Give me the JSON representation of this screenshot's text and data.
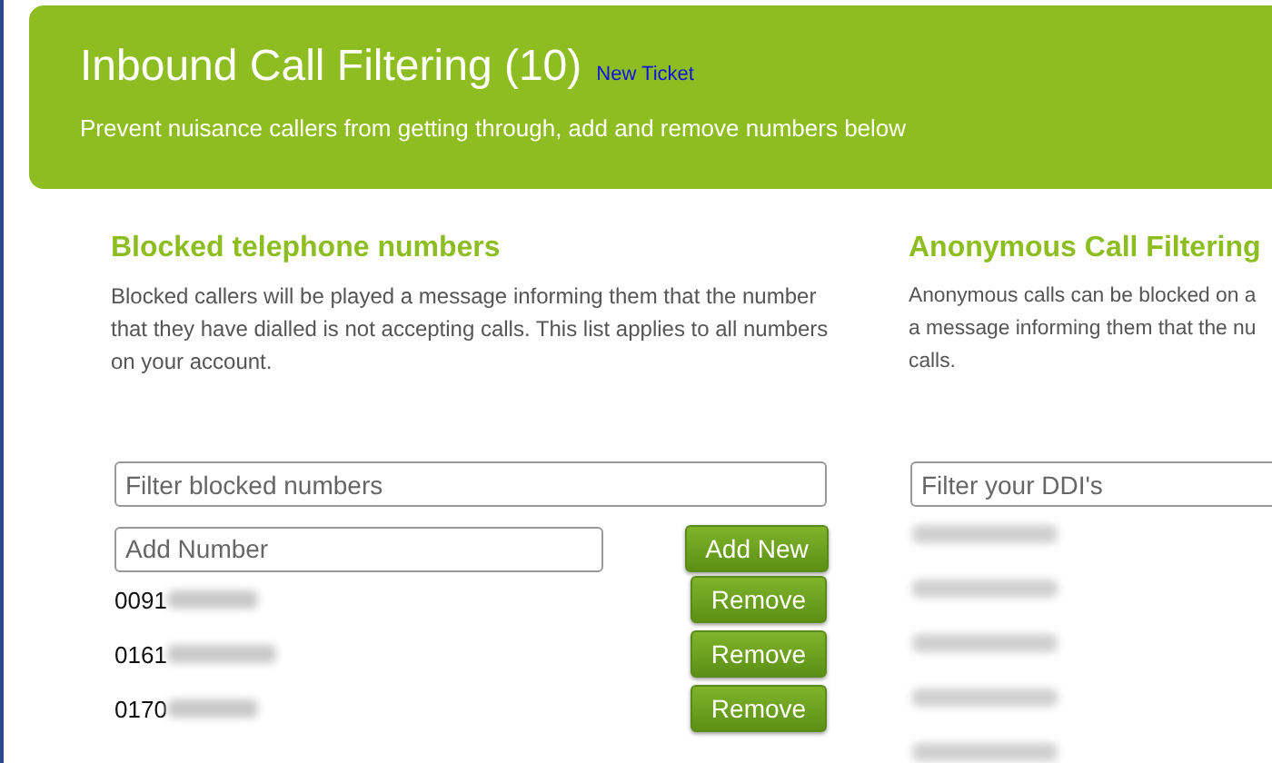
{
  "header": {
    "title": "Inbound Call Filtering (10)",
    "link": "New Ticket",
    "subtitle": "Prevent nuisance callers from getting through, add and remove numbers below"
  },
  "blocked": {
    "heading": "Blocked telephone numbers",
    "description": "Blocked callers will be played a message informing them that the number that they have dialled is not accepting calls. This list applies to all numbers on your account.",
    "filter": {
      "placeholder": "Filter blocked numbers"
    },
    "add": {
      "placeholder": "Add Number",
      "button": "Add New"
    },
    "rows": [
      {
        "number": "0091",
        "button": "Remove"
      },
      {
        "number": "0161",
        "button": "Remove"
      },
      {
        "number": "0170",
        "button": "Remove"
      }
    ]
  },
  "anonymous": {
    "heading": "Anonymous Call Filtering",
    "description_lines": [
      "Anonymous calls can be blocked on a",
      "a message informing them that the nu",
      "calls."
    ],
    "filter": {
      "placeholder": "Filter your DDI's"
    }
  }
}
